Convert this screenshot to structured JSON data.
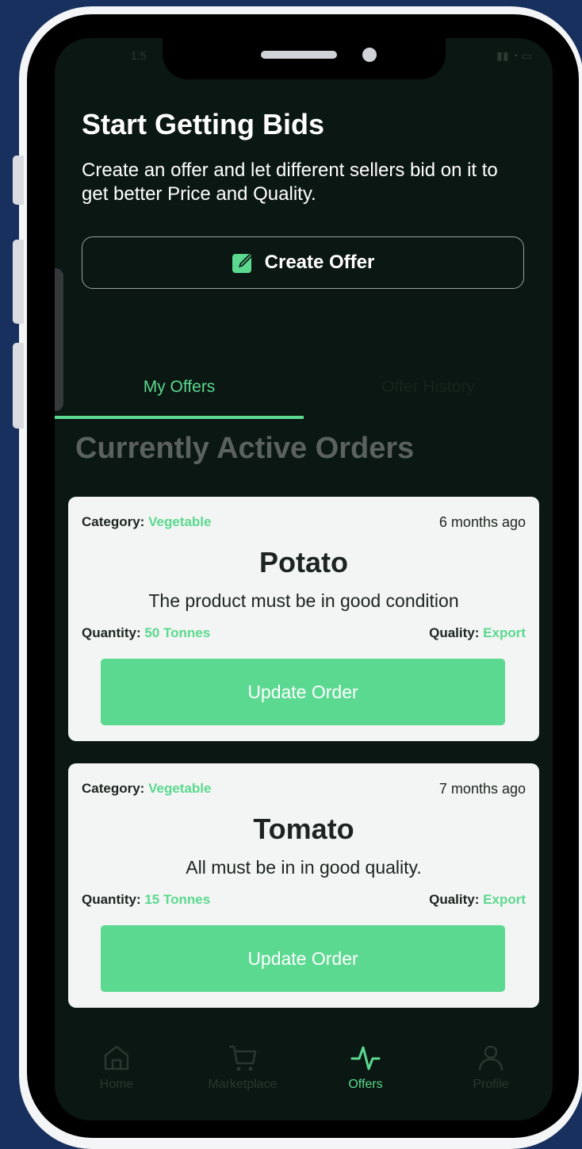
{
  "status_bar": {
    "time": "1:5",
    "icons": "signal-wifi-battery"
  },
  "header": {
    "title": "Start Getting Bids",
    "subtitle": "Create an offer and let different sellers bid on it to get better Price and Quality.",
    "create_button": {
      "label": "Create Offer",
      "icon": "edit-icon"
    }
  },
  "tabs": [
    {
      "label": "My Offers",
      "active": true
    },
    {
      "label": "Offer History",
      "active": false
    }
  ],
  "section_title": "Currently Active Orders",
  "orders": [
    {
      "category_label": "Category:",
      "category": "Vegetable",
      "time_ago": "6 months ago",
      "product": "Potato",
      "description": "The product must be in good condition",
      "quantity_label": "Quantity:",
      "quantity": "50 Tonnes",
      "quality_label": "Quality:",
      "quality": "Export",
      "button": "Update Order"
    },
    {
      "category_label": "Category:",
      "category": "Vegetable",
      "time_ago": "7 months ago",
      "product": "Tomato",
      "description": "All must be in in good quality.",
      "quantity_label": "Quantity:",
      "quantity": "15 Tonnes",
      "quality_label": "Quality:",
      "quality": "Export",
      "button": "Update Order"
    }
  ],
  "bottom_nav": [
    {
      "label": "Home",
      "icon": "home-icon",
      "active": false
    },
    {
      "label": "Marketplace",
      "icon": "cart-icon",
      "active": false
    },
    {
      "label": "Offers",
      "icon": "activity-icon",
      "active": true
    },
    {
      "label": "Profile",
      "icon": "user-icon",
      "active": false
    }
  ],
  "colors": {
    "accent": "#5bd98f",
    "screen_bg": "#0b1712",
    "card_bg": "#f2f5f3",
    "page_bg": "#17305e"
  }
}
